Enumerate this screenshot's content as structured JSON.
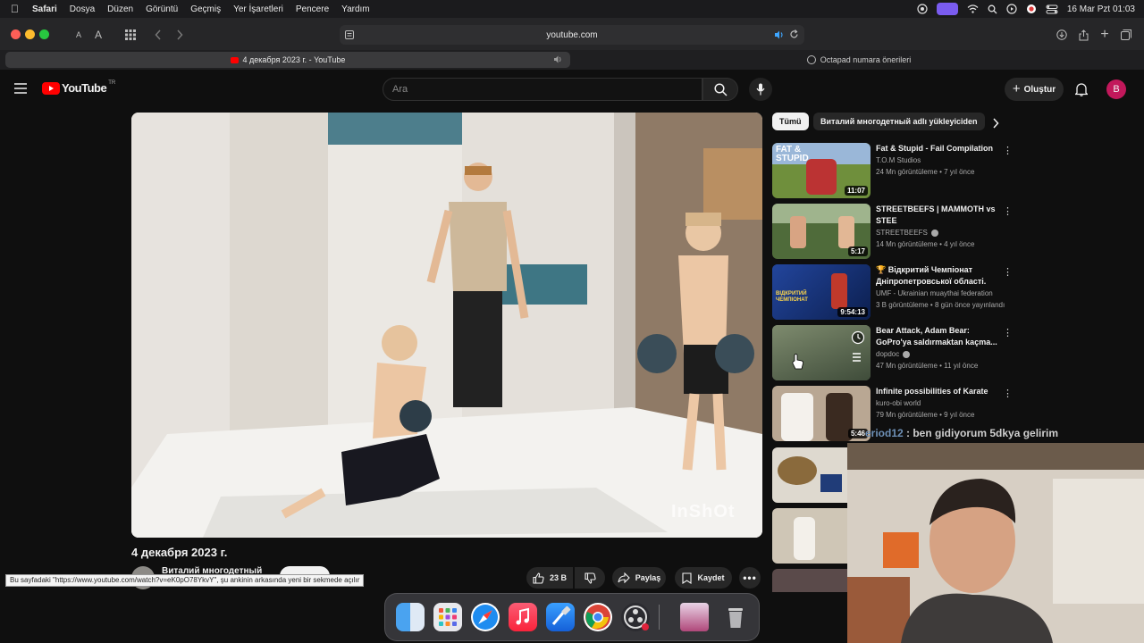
{
  "menubar": {
    "app": "Safari",
    "items": [
      "Dosya",
      "Düzen",
      "Görüntü",
      "Geçmiş",
      "Yer İşaretleri",
      "Pencere",
      "Yardım"
    ],
    "datetime": "16 Mar Pzt  01:03"
  },
  "toolbar": {
    "text_small": "A",
    "text_large": "A",
    "url": "youtube.com"
  },
  "tabs": [
    {
      "label": "4 декабря 2023 г. - YouTube"
    },
    {
      "label": "Octapad numara önerileri"
    }
  ],
  "youtube": {
    "logo": "YouTube",
    "region": "TR",
    "search_placeholder": "Ara",
    "create_label": "Oluştur",
    "avatar_letter": "B"
  },
  "video": {
    "watermark": "InShOt",
    "title": "4 декабря 2023 г.",
    "channel": "Виталий многодетный",
    "likes": "23 B",
    "share_label": "Paylaş",
    "save_label": "Kaydet"
  },
  "status_link": "Bu sayfadaki \"https://www.youtube.com/watch?v=eK0pO78YkvY\", şu ankinin arkasında yeni bir sekmede açılır",
  "chips": [
    "Tümü",
    "Виталий многодетный adlı yükleyiciden"
  ],
  "recommendations": [
    {
      "title": "Fat & Stupid - Fail Compilation",
      "channel": "T.O.M Studios",
      "meta": "24 Mn görüntüleme • 7 yıl önce",
      "duration": "11:07",
      "thumb_text": "FAT & STUPID",
      "thumb_color": "#6f8f3c"
    },
    {
      "title": "STREETBEEFS | MAMMOTH vs STEE",
      "channel": "STREETBEEFS",
      "meta": "14 Mn görüntüleme • 4 yıl önce",
      "duration": "5:17",
      "thumb_text": "",
      "thumb_color": "#4f6b3a"
    },
    {
      "title": "🏆 Відкритий Чемпіонат Дніпропетровської області.",
      "channel": "UMF - Ukrainian muaythai federation",
      "meta": "3 B görüntüleme • 8 gün önce yayınlandı",
      "duration": "9:54:13",
      "thumb_text": "ВІДКРИТИЙ ЧЕМПІОНАТ",
      "thumb_color": "#1d3e8a"
    },
    {
      "title": "Bear Attack, Adam Bear: GoPro'ya saldırmaktan kaçma...",
      "channel": "dopdoc",
      "meta": "47 Mn görüntüleme • 11 yıl önce",
      "duration": "",
      "thumb_text": "",
      "thumb_color": "#5c6a55"
    },
    {
      "title": "Infinite possibilities of Karate",
      "channel": "kuro-obi world",
      "meta": "79 Mn görüntüleme • 9 yıl önce",
      "duration": "5:46",
      "thumb_text": "",
      "thumb_color": "#b9a793"
    }
  ],
  "chat_overlay": {
    "user": "eriod12",
    "message": " : ben gidiyorum 5dkya gelirim"
  },
  "colors": {
    "yt_red": "#ff0000",
    "accent_blue": "#3ea6ff"
  }
}
